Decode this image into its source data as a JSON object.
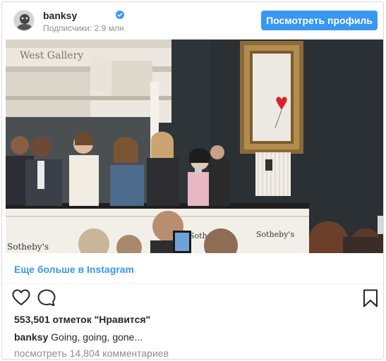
{
  "post": {
    "username": "banksy",
    "followers": "Подписчики: 2.9 млн",
    "view_profile_label": "Посмотреть профиль",
    "photo_signs": {
      "gallery": "West Gallery",
      "sothebys_left": "Sotheby's",
      "sothebys_mid": "Sotheby's",
      "sothebys_right": "Sotheby's"
    },
    "more_link": "Еще больше в Instagram",
    "likes": "553,501 отметок \"Нравится\"",
    "caption_user": "banksy",
    "caption_text": "Going, going, gone...",
    "comments_link": "посмотреть 14,804 комментариев"
  },
  "colors": {
    "accent": "#3897f0",
    "text": "#262626",
    "muted": "#8e8e8e",
    "border": "#dbdbdb",
    "balloon_red": "#d8232a"
  },
  "icons": [
    "verified-badge-icon",
    "heart-icon",
    "comment-icon",
    "bookmark-icon"
  ]
}
